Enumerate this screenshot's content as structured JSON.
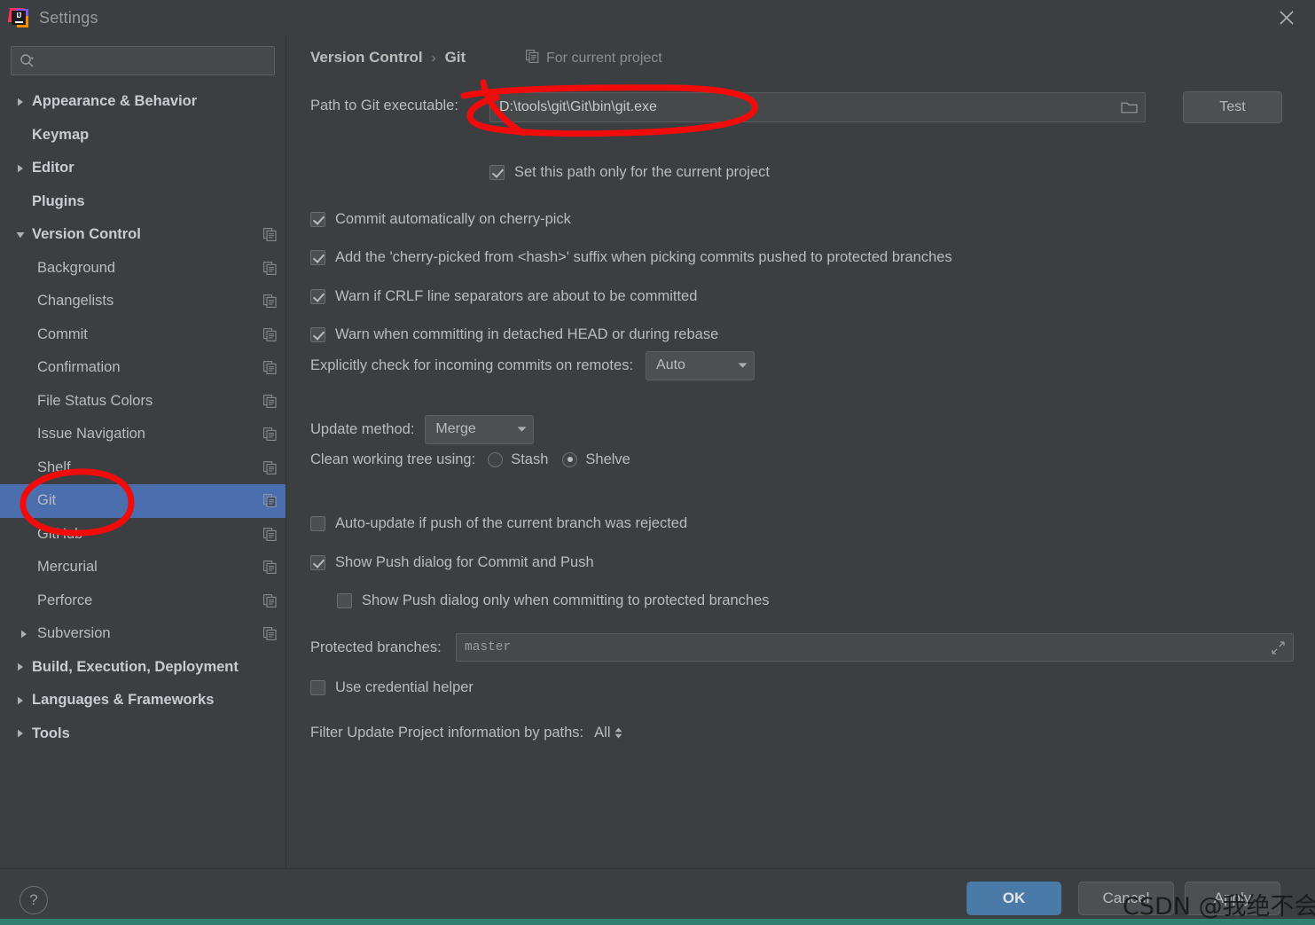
{
  "window": {
    "title": "Settings",
    "logo_text": "IJ",
    "close_icon": "close-icon"
  },
  "sidebar": {
    "search": {
      "placeholder": "",
      "value": "",
      "icon": "search-icon"
    },
    "items": [
      {
        "label": "Appearance & Behavior",
        "level": 0,
        "arrow": "right",
        "bold": true,
        "copy": false,
        "selected": false
      },
      {
        "label": "Keymap",
        "level": 0,
        "arrow": "none",
        "bold": true,
        "copy": false,
        "selected": false
      },
      {
        "label": "Editor",
        "level": 0,
        "arrow": "right",
        "bold": true,
        "copy": false,
        "selected": false
      },
      {
        "label": "Plugins",
        "level": 0,
        "arrow": "none",
        "bold": true,
        "copy": false,
        "selected": false
      },
      {
        "label": "Version Control",
        "level": 0,
        "arrow": "down",
        "bold": true,
        "copy": true,
        "selected": false
      },
      {
        "label": "Background",
        "level": 1,
        "arrow": "none",
        "bold": false,
        "copy": true,
        "selected": false
      },
      {
        "label": "Changelists",
        "level": 1,
        "arrow": "none",
        "bold": false,
        "copy": true,
        "selected": false
      },
      {
        "label": "Commit",
        "level": 1,
        "arrow": "none",
        "bold": false,
        "copy": true,
        "selected": false
      },
      {
        "label": "Confirmation",
        "level": 1,
        "arrow": "none",
        "bold": false,
        "copy": true,
        "selected": false
      },
      {
        "label": "File Status Colors",
        "level": 1,
        "arrow": "none",
        "bold": false,
        "copy": true,
        "selected": false
      },
      {
        "label": "Issue Navigation",
        "level": 1,
        "arrow": "none",
        "bold": false,
        "copy": true,
        "selected": false
      },
      {
        "label": "Shelf",
        "level": 1,
        "arrow": "none",
        "bold": false,
        "copy": true,
        "selected": false
      },
      {
        "label": "Git",
        "level": 1,
        "arrow": "none",
        "bold": false,
        "copy": true,
        "selected": true
      },
      {
        "label": "GitHub",
        "level": 1,
        "arrow": "none",
        "bold": false,
        "copy": true,
        "selected": false
      },
      {
        "label": "Mercurial",
        "level": 1,
        "arrow": "none",
        "bold": false,
        "copy": true,
        "selected": false
      },
      {
        "label": "Perforce",
        "level": 1,
        "arrow": "none",
        "bold": false,
        "copy": true,
        "selected": false
      },
      {
        "label": "Subversion",
        "level": 1,
        "arrow": "right",
        "bold": false,
        "copy": true,
        "selected": false
      },
      {
        "label": "Build, Execution, Deployment",
        "level": 0,
        "arrow": "right",
        "bold": true,
        "copy": false,
        "selected": false
      },
      {
        "label": "Languages & Frameworks",
        "level": 0,
        "arrow": "right",
        "bold": true,
        "copy": false,
        "selected": false
      },
      {
        "label": "Tools",
        "level": 0,
        "arrow": "right",
        "bold": true,
        "copy": false,
        "selected": false
      }
    ]
  },
  "main": {
    "breadcrumb": {
      "parent": "Version Control",
      "separator": "›",
      "current": "Git"
    },
    "scope_note": {
      "icon": "copy-scope-icon",
      "text": "For current project"
    },
    "path_row": {
      "label": "Path to Git executable:",
      "value": "D:\\tools\\git\\Git\\bin\\git.exe",
      "browse_icon": "folder-icon",
      "test_button": "Test"
    },
    "set_path_only": {
      "label": "Set this path only for the current project",
      "checked": true
    },
    "checkboxes": [
      {
        "label": "Commit automatically on cherry-pick",
        "checked": true
      },
      {
        "label": "Add the 'cherry-picked from <hash>' suffix when picking commits pushed to protected branches",
        "checked": true
      },
      {
        "label": "Warn if CRLF line separators are about to be committed",
        "checked": true
      },
      {
        "label": "Warn when committing in detached HEAD or during rebase",
        "checked": true
      }
    ],
    "incoming_commits": {
      "label": "Explicitly check for incoming commits on remotes:",
      "value": "Auto"
    },
    "update_method": {
      "label": "Update method:",
      "value": "Merge"
    },
    "clean_tree": {
      "label": "Clean working tree using:",
      "options": [
        {
          "label": "Stash",
          "selected": false
        },
        {
          "label": "Shelve",
          "selected": true
        }
      ]
    },
    "auto_update": {
      "label": "Auto-update if push of the current branch was rejected",
      "checked": false
    },
    "show_push_dialog": {
      "label": "Show Push dialog for Commit and Push",
      "checked": true
    },
    "show_push_protected": {
      "label": "Show Push dialog only when committing to protected branches",
      "checked": false
    },
    "protected_branches": {
      "label": "Protected branches:",
      "value": "master",
      "expand_icon": "expand-icon"
    },
    "use_credential_helper": {
      "label": "Use credential helper",
      "checked": false
    },
    "filter_update": {
      "label": "Filter Update Project information by paths:",
      "value": "All"
    }
  },
  "footer": {
    "help_label": "?",
    "ok_label": "OK",
    "cancel_label": "Cancel",
    "apply_label": "Apply"
  },
  "watermark": {
    "text": "CSDN @我绝不会倒下"
  },
  "colors": {
    "window_bg": "#3c3f41",
    "selection_blue": "#4b6eaf",
    "ok_button": "#4a7aa8",
    "annotation_red": "#f20b0b",
    "accent_strip": "#31806f"
  }
}
